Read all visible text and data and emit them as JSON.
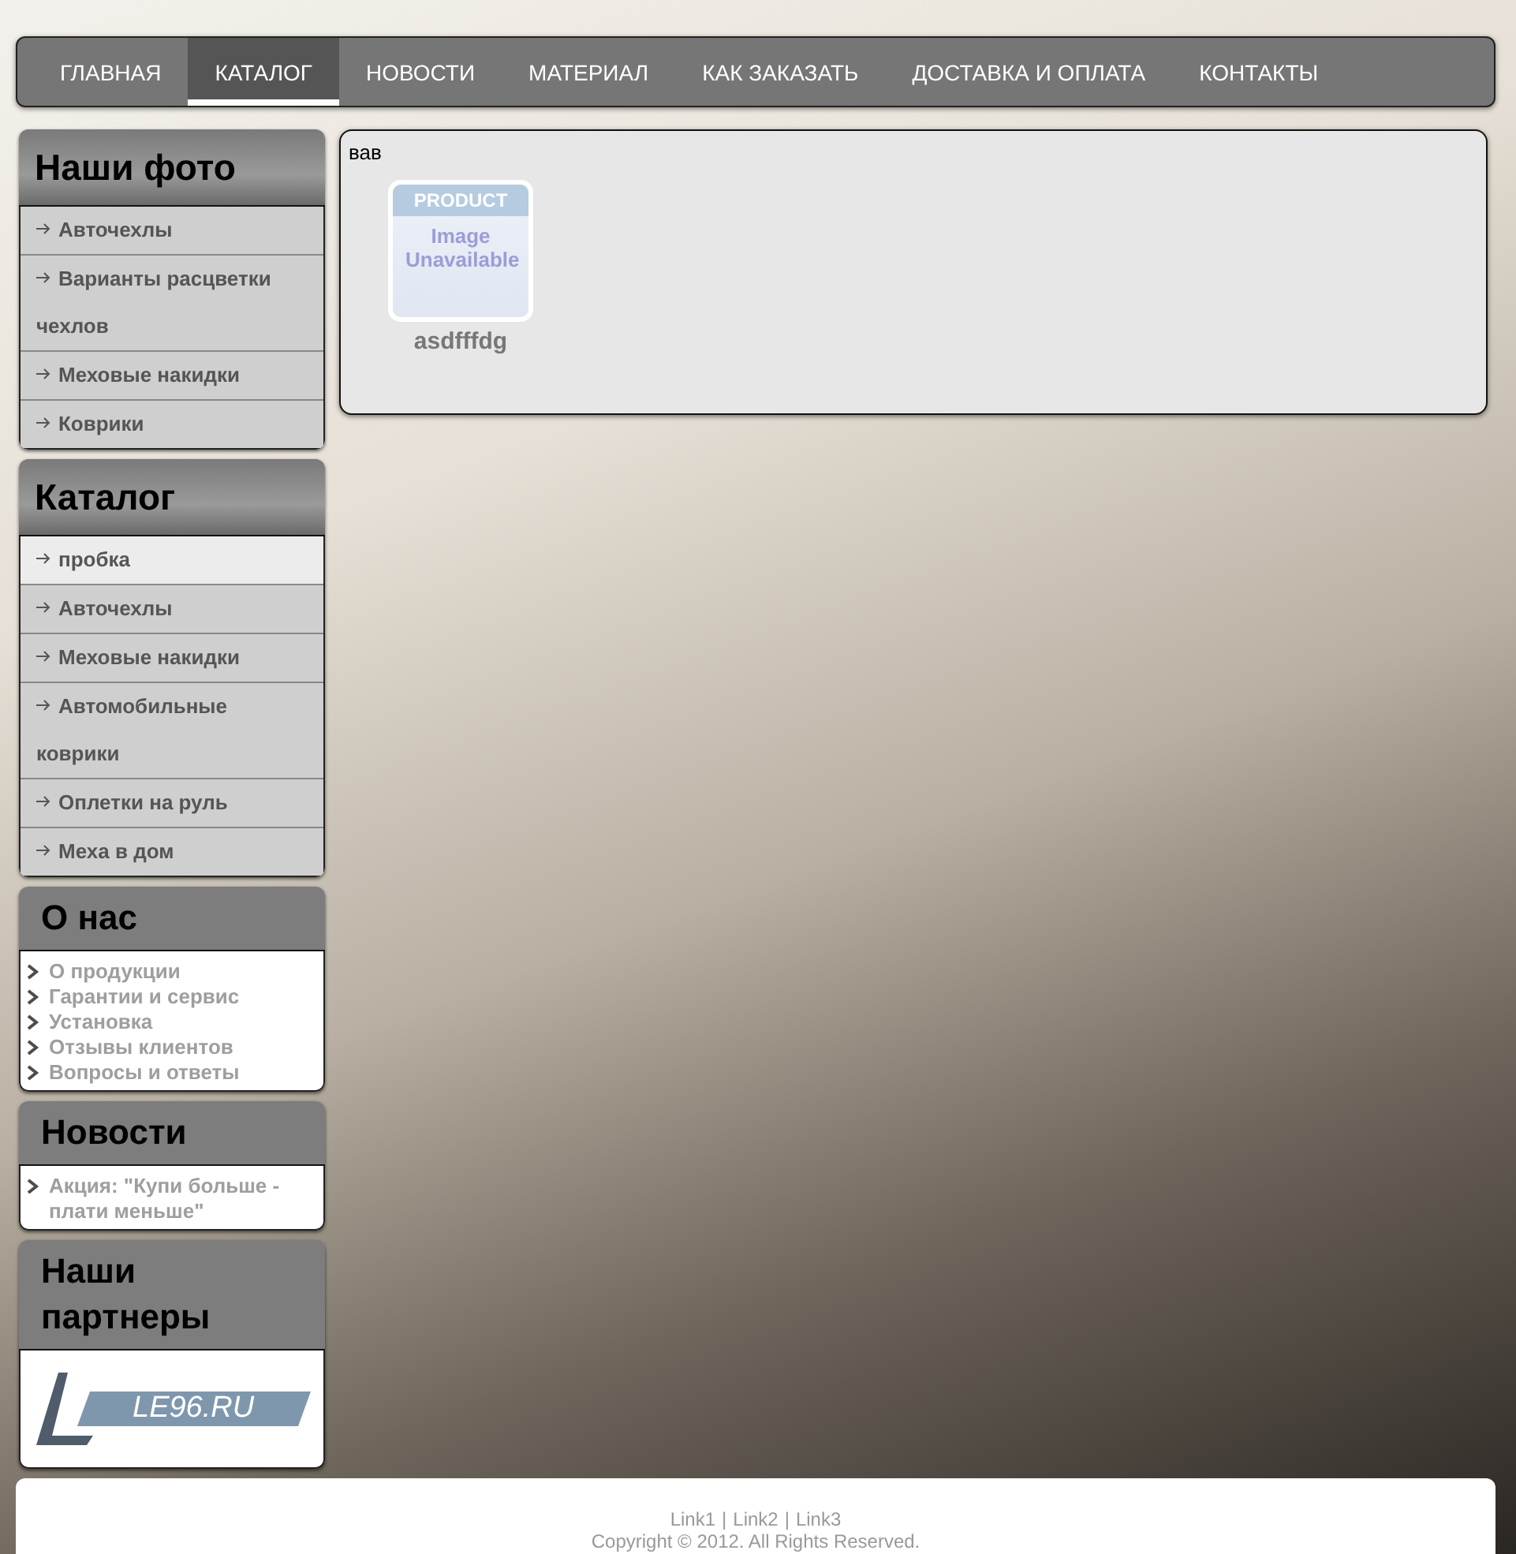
{
  "nav": {
    "items": [
      {
        "label": "ГЛАВНАЯ",
        "selected": false
      },
      {
        "label": "КАТАЛОГ",
        "selected": true
      },
      {
        "label": "НОВОСТИ",
        "selected": false
      },
      {
        "label": "МАТЕРИАЛ",
        "selected": false
      },
      {
        "label": "КАК ЗАКАЗАТЬ",
        "selected": false
      },
      {
        "label": "ДОСТАВКА И ОПЛАТА",
        "selected": false
      },
      {
        "label": "КОНТАКТЫ",
        "selected": false
      }
    ]
  },
  "sidebar": [
    {
      "kind": "menu",
      "title": "Наши фото",
      "items": [
        {
          "label": "Авточехлы",
          "selected": false
        },
        {
          "label": "Варианты расцветки чехлов",
          "selected": false
        },
        {
          "label": "Меховые накидки",
          "selected": false
        },
        {
          "label": "Коврики",
          "selected": false
        }
      ]
    },
    {
      "kind": "menu",
      "title": "Каталог",
      "items": [
        {
          "label": "пробка",
          "selected": true
        },
        {
          "label": "Авточехлы",
          "selected": false
        },
        {
          "label": "Меховые накидки",
          "selected": false
        },
        {
          "label": "Автомобильные коврики",
          "selected": false
        },
        {
          "label": "Оплетки на руль",
          "selected": false
        },
        {
          "label": "Меха в дом",
          "selected": false
        }
      ]
    },
    {
      "kind": "links",
      "title": "О нас",
      "items": [
        {
          "label": "О продукции"
        },
        {
          "label": "Гарантии и сервис"
        },
        {
          "label": "Установка"
        },
        {
          "label": "Отзывы клиентов"
        },
        {
          "label": "Вопросы и ответы"
        }
      ]
    },
    {
      "kind": "links",
      "title": "Новости",
      "items": [
        {
          "label": "Акция: \"Купи больше - плати меньше\""
        }
      ]
    },
    {
      "kind": "logo",
      "title": "Наши партнеры",
      "logo_text": "LE96.RU"
    }
  ],
  "content": {
    "text": "вав",
    "products": [
      {
        "image_header": "PRODUCT",
        "image_text": "Image Unavailable",
        "name": "asdfffdg"
      }
    ]
  },
  "footer": {
    "links": [
      "Link1",
      "Link2",
      "Link3"
    ],
    "separator": "|",
    "copyright": "Copyright © 2012. All Rights Reserved."
  }
}
